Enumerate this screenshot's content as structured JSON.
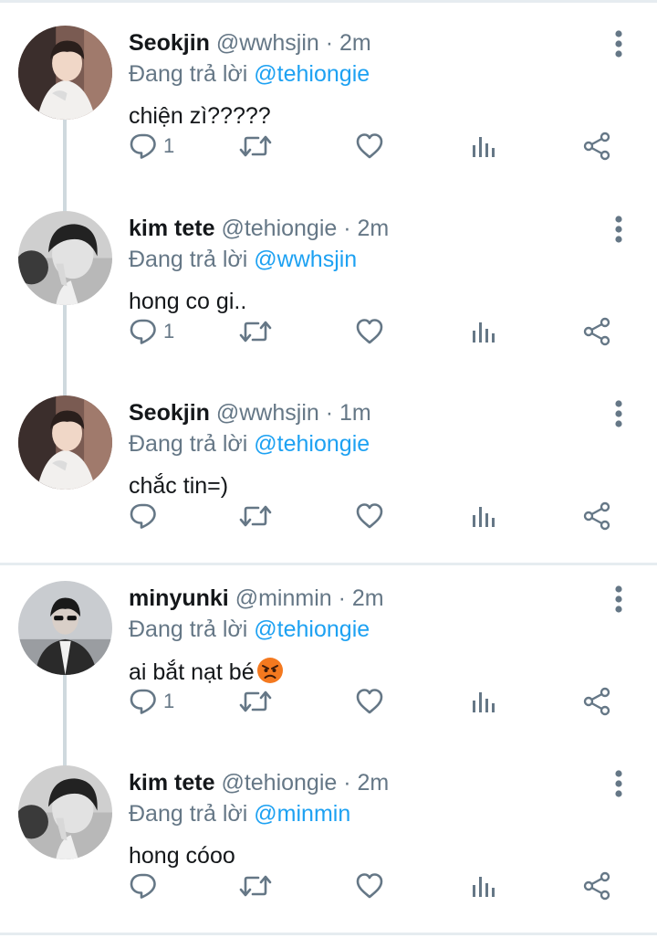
{
  "reply_prefix": "Đang trả lời",
  "tweets": [
    {
      "name": "Seokjin",
      "handle": "@wwhsjin",
      "time": "2m",
      "reply_to": "@tehiongie",
      "text": "chiện zì?????",
      "reply_count": "1",
      "avatar": "seokjin"
    },
    {
      "name": "kim tete",
      "handle": "@tehiongie",
      "time": "2m",
      "reply_to": "@wwhsjin",
      "text": "hong co gi..",
      "reply_count": "1",
      "avatar": "kimtete"
    },
    {
      "name": "Seokjin",
      "handle": "@wwhsjin",
      "time": "1m",
      "reply_to": "@tehiongie",
      "text": "chắc tin=)",
      "reply_count": "",
      "avatar": "seokjin"
    },
    {
      "name": "minyunki",
      "handle": "@minmin",
      "time": "2m",
      "reply_to": "@tehiongie",
      "text": "ai bắt nạt bé",
      "reply_count": "1",
      "avatar": "minyunki",
      "emoji": "angry-face"
    },
    {
      "name": "kim tete",
      "handle": "@tehiongie",
      "time": "2m",
      "reply_to": "@minmin",
      "text": "hong cóoo",
      "reply_count": "",
      "avatar": "kimtete"
    }
  ],
  "icons": [
    "reply-icon",
    "retweet-icon",
    "like-icon",
    "analytics-icon",
    "share-icon",
    "more-options-icon"
  ],
  "colors": {
    "text": "#14171a",
    "secondary": "#657786",
    "link": "#1da1f2",
    "icon": "#657786",
    "divider": "#e6ecf0",
    "thread": "#cfd9de"
  }
}
